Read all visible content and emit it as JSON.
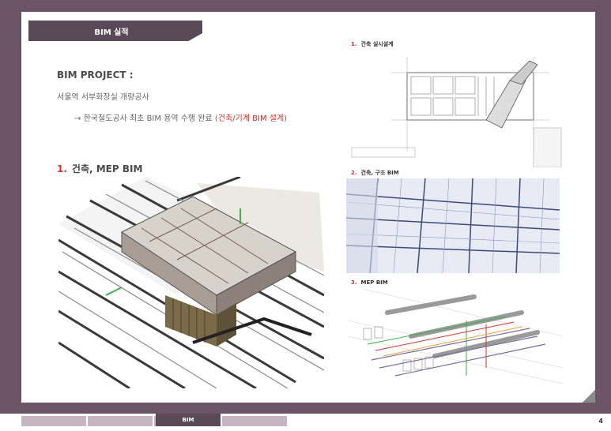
{
  "section_tab": "BIM 실적",
  "project": {
    "title": "BIM PROJECT :",
    "subtitle": "서울역 서부화장실 개량공사",
    "detail_arrow": "→",
    "detail_prefix": "한국철도공사 최초 BIM 용역 수행 완료 (",
    "detail_highlight": "건축/기계 BIM 설계",
    "detail_suffix": ")"
  },
  "section1": {
    "num": "1.",
    "label": "건축, MEP BIM"
  },
  "captions": [
    {
      "num": "1.",
      "label": "건축 실시설계"
    },
    {
      "num": "2.",
      "label": "건축, 구조 BIM"
    },
    {
      "num": "3.",
      "label": "MEP BIM"
    }
  ],
  "footer": {
    "tabs": [
      "",
      "",
      "",
      "BIM",
      ""
    ],
    "active_tab": "BIM",
    "page_number": "4"
  },
  "colors": {
    "brand": "#6b5466",
    "tab_dark": "#5a4a57",
    "tab_light": "#c7b5c4",
    "accent": "#d4352a"
  }
}
